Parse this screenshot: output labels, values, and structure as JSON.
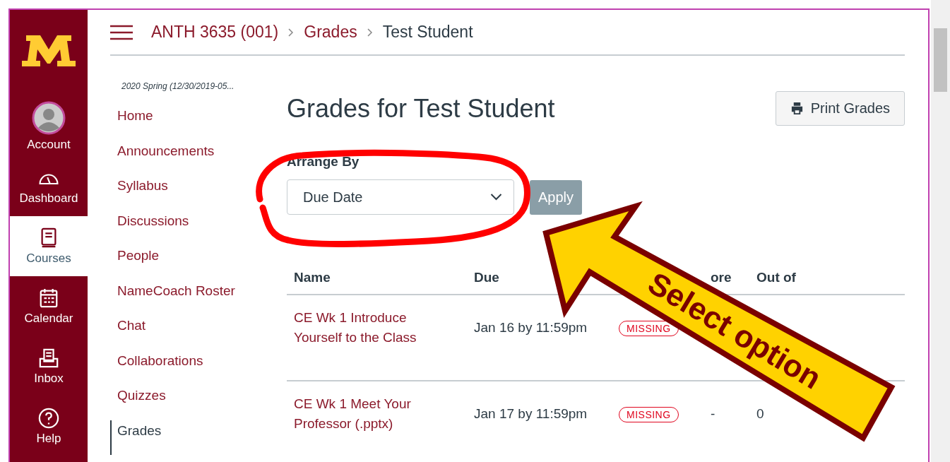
{
  "global_nav": [
    {
      "label": "Account",
      "kind": "avatar",
      "selected": false
    },
    {
      "label": "Dashboard",
      "kind": "dashboard",
      "selected": false
    },
    {
      "label": "Courses",
      "kind": "courses",
      "selected": true
    },
    {
      "label": "Calendar",
      "kind": "calendar",
      "selected": false
    },
    {
      "label": "Inbox",
      "kind": "inbox",
      "selected": false
    },
    {
      "label": "Help",
      "kind": "help",
      "selected": false
    }
  ],
  "breadcrumbs": [
    "ANTH 3635 (001)",
    "Grades",
    "Test Student"
  ],
  "course_nav": {
    "term": "2020 Spring (12/30/2019-05...",
    "items": [
      {
        "label": "Home",
        "selected": false
      },
      {
        "label": "Announcements",
        "selected": false
      },
      {
        "label": "Syllabus",
        "selected": false
      },
      {
        "label": "Discussions",
        "selected": false
      },
      {
        "label": "People",
        "selected": false
      },
      {
        "label": "NameCoach Roster",
        "selected": false
      },
      {
        "label": "Chat",
        "selected": false
      },
      {
        "label": "Collaborations",
        "selected": false
      },
      {
        "label": "Quizzes",
        "selected": false
      },
      {
        "label": "Grades",
        "selected": true
      }
    ]
  },
  "page_title": "Grades for Test Student",
  "print_button": "Print Grades",
  "arrange": {
    "label": "Arrange By",
    "value": "Due Date",
    "apply": "Apply"
  },
  "table": {
    "columns": [
      "Name",
      "Due",
      "",
      "ore",
      "Out of"
    ],
    "rows": [
      {
        "name": "CE Wk 1 Introduce Yourself to the Class",
        "due": "Jan 16 by 11:59pm",
        "status": "MISSING"
      },
      {
        "name": "CE Wk 1 Meet Your Professor (.pptx)",
        "due": "Jan 17 by 11:59pm",
        "status": "MISSING",
        "score": "-",
        "out_of": "0"
      }
    ]
  },
  "annotation": {
    "label": "Select option"
  }
}
